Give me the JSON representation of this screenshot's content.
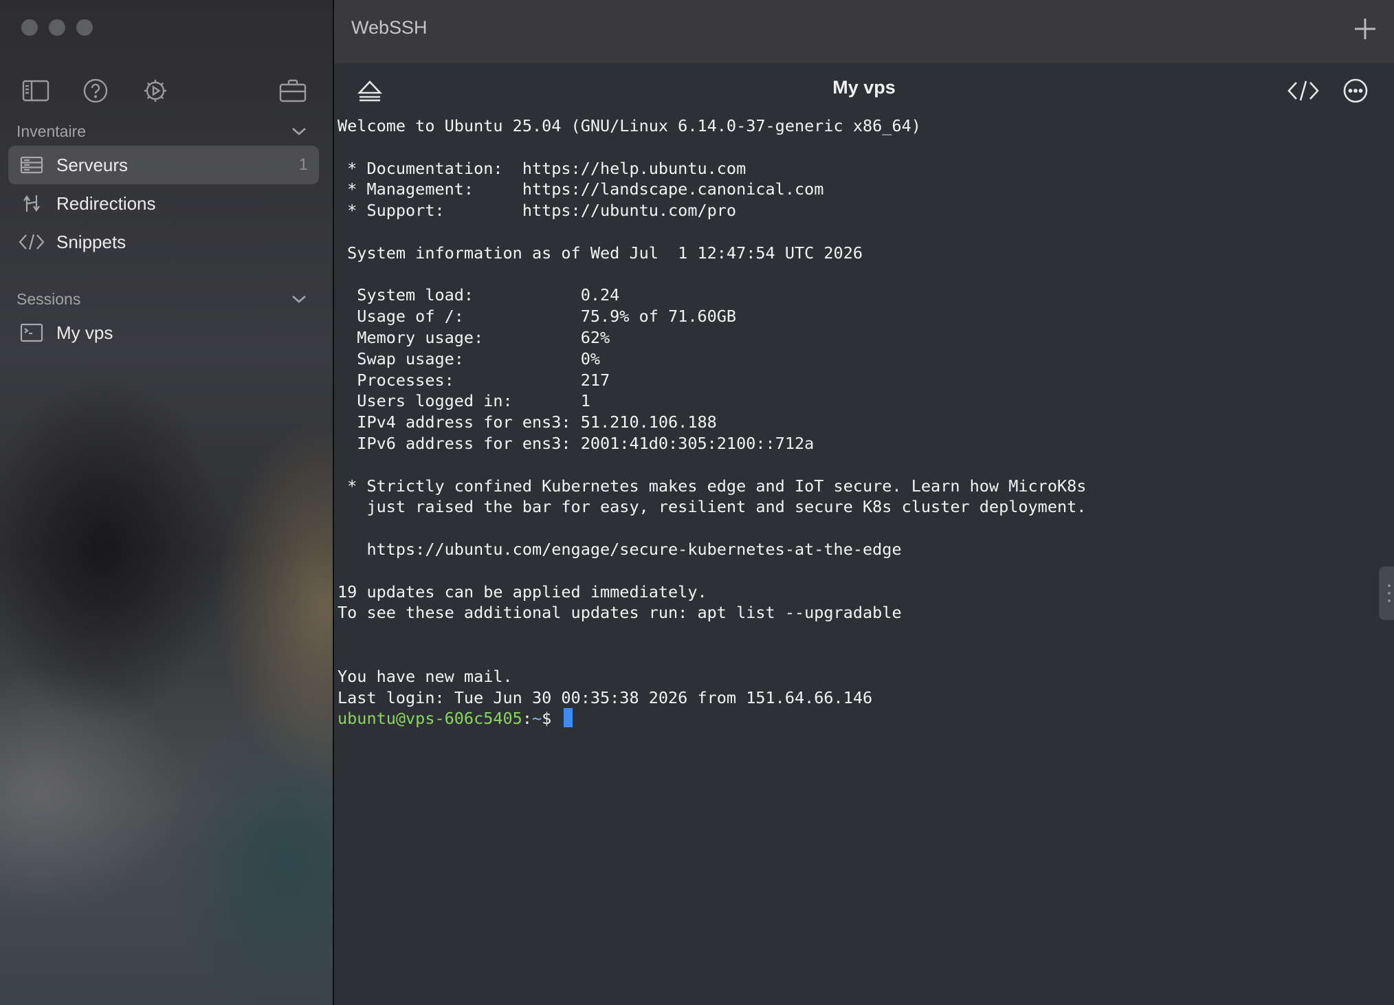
{
  "window": {
    "title": "WebSSH"
  },
  "sidebar": {
    "toolbar_icons": [
      "sidebar-toggle-icon",
      "help-icon",
      "settings-icon",
      "briefcase-icon"
    ],
    "sections": [
      {
        "label": "Inventaire",
        "items": [
          {
            "label": "Serveurs",
            "count": "1",
            "icon": "server-icon",
            "selected": true
          },
          {
            "label": "Redirections",
            "icon": "redirect-icon"
          },
          {
            "label": "Snippets",
            "icon": "code-icon"
          }
        ]
      },
      {
        "label": "Sessions",
        "items": [
          {
            "label": "My vps",
            "icon": "terminal-icon"
          }
        ]
      }
    ]
  },
  "session": {
    "title": "My vps",
    "buttons": [
      "eject-icon",
      "code-icon",
      "more-icon"
    ]
  },
  "terminal": {
    "lines": [
      "Welcome to Ubuntu 25.04 (GNU/Linux 6.14.0-37-generic x86_64)",
      "",
      " * Documentation:  https://help.ubuntu.com",
      " * Management:     https://landscape.canonical.com",
      " * Support:        https://ubuntu.com/pro",
      "",
      " System information as of Wed Jul  1 12:47:54 UTC 2026",
      "",
      "  System load:           0.24",
      "  Usage of /:            75.9% of 71.60GB",
      "  Memory usage:          62%",
      "  Swap usage:            0%",
      "  Processes:             217",
      "  Users logged in:       1",
      "  IPv4 address for ens3: 51.210.106.188",
      "  IPv6 address for ens3: 2001:41d0:305:2100::712a",
      "",
      " * Strictly confined Kubernetes makes edge and IoT secure. Learn how MicroK8s",
      "   just raised the bar for easy, resilient and secure K8s cluster deployment.",
      "",
      "   https://ubuntu.com/engage/secure-kubernetes-at-the-edge",
      "",
      "19 updates can be applied immediately.",
      "To see these additional updates run: apt list --upgradable",
      "",
      "",
      "You have new mail.",
      "Last login: Tue Jun 30 00:35:38 2026 from 151.64.66.146"
    ],
    "prompt": {
      "user_host": "ubuntu@vps-606c5405",
      "separator": ":",
      "path": "~",
      "symbol": "$ "
    }
  },
  "colors": {
    "prompt_user": "#8ad65e",
    "cursor": "#3c8cf3",
    "terminal_bg": "#2d3035",
    "titlebar_bg": "#3a3a3c"
  }
}
